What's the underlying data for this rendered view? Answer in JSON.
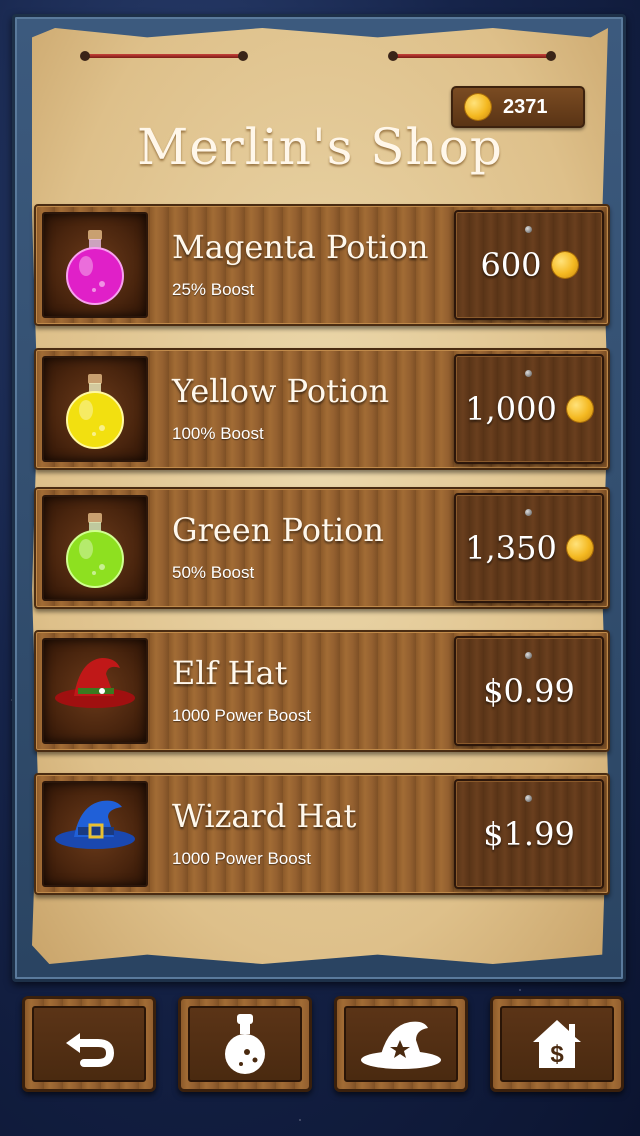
{
  "header": {
    "title": "Merlin's Shop",
    "coin_balance": "2371"
  },
  "items": [
    {
      "name": "Magenta Potion",
      "description": "25% Boost",
      "price": "600",
      "currency": "coins",
      "icon": "magenta-potion-icon",
      "color": "#e020c8"
    },
    {
      "name": "Yellow Potion",
      "description": "100% Boost",
      "price": "1,000",
      "currency": "coins",
      "icon": "yellow-potion-icon",
      "color": "#f2e010"
    },
    {
      "name": "Green Potion",
      "description": "50% Boost",
      "price": "1,350",
      "currency": "coins",
      "icon": "green-potion-icon",
      "color": "#8ee020"
    },
    {
      "name": "Elf Hat",
      "description": "1000 Power Boost",
      "price": "$0.99",
      "currency": "usd",
      "icon": "elf-hat-icon",
      "color": "#c01818"
    },
    {
      "name": "Wizard Hat",
      "description": "1000 Power Boost",
      "price": "$1.99",
      "currency": "usd",
      "icon": "wizard-hat-icon",
      "color": "#2060d8"
    }
  ],
  "bottom_nav": [
    {
      "icon": "back-arrow-icon"
    },
    {
      "icon": "potion-icon"
    },
    {
      "icon": "wizard-hat-icon"
    },
    {
      "icon": "house-dollar-icon"
    }
  ],
  "colors": {
    "parchment": "#dec08a",
    "wood": "#946030",
    "frame": "#3c5a7e",
    "coin": "#f4b820"
  }
}
